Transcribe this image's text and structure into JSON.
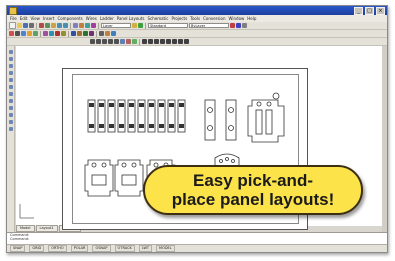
{
  "window": {
    "title": "",
    "controls": [
      "_",
      "□",
      "×"
    ]
  },
  "menubar": {
    "items": [
      "File",
      "Edit",
      "View",
      "Insert",
      "Components",
      "Wires",
      "Ladder",
      "Panel Layouts",
      "Schematic",
      "Projects",
      "Tools",
      "Conversion",
      "Window",
      "Help"
    ]
  },
  "toolbars": {
    "combo_layer": "Layer",
    "combo_style": "Standard",
    "combo_bylayer": "ByLayer"
  },
  "icons": {
    "app": "app-icon",
    "panel_component": "panel-component-icon"
  },
  "tabs": [
    "Model",
    "Layout1",
    "Layout2"
  ],
  "command_line": {
    "line1": "Command:",
    "line2": "Command:"
  },
  "statusbar": {
    "items": [
      "SNAP",
      "GRID",
      "ORTHO",
      "POLAR",
      "OSNAP",
      "OTRACK",
      "LWT",
      "MODEL"
    ]
  },
  "callout": {
    "line1": "Easy pick-and-",
    "line2": "place panel layouts!",
    "color": "#fde34a"
  }
}
